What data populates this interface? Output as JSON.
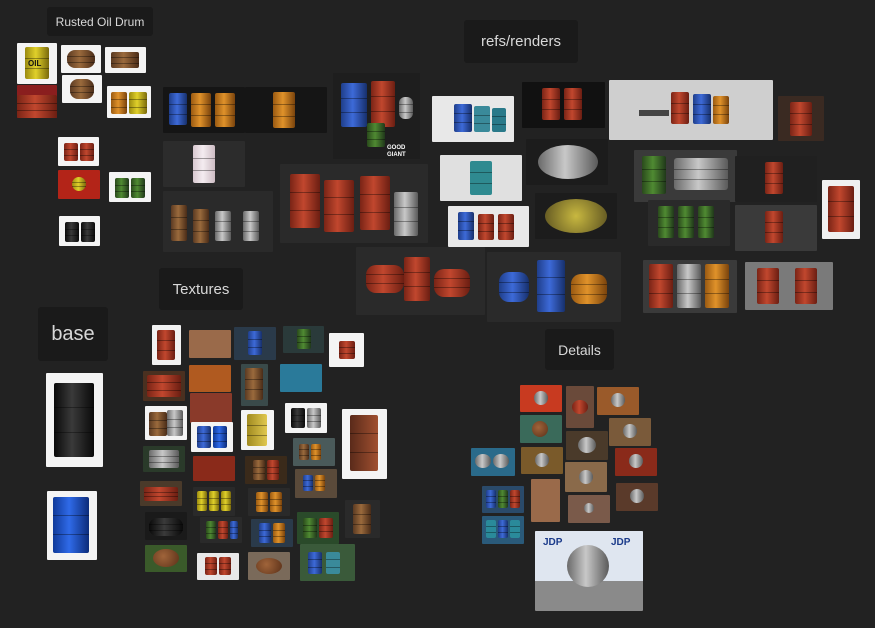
{
  "labels": {
    "rusted_oil_drum": "Rusted Oil Drum",
    "refs_renders": "refs/renders",
    "textures": "Textures",
    "base": "base",
    "details": "Details"
  },
  "thumb_text": {
    "oil": "OIL",
    "good_giant": "GOOD GIANT",
    "jdp": "JDP"
  },
  "colors": {
    "canvas_bg": "#222222",
    "label_bg": "#1a1a1a",
    "label_text": "#d8d8d8"
  }
}
